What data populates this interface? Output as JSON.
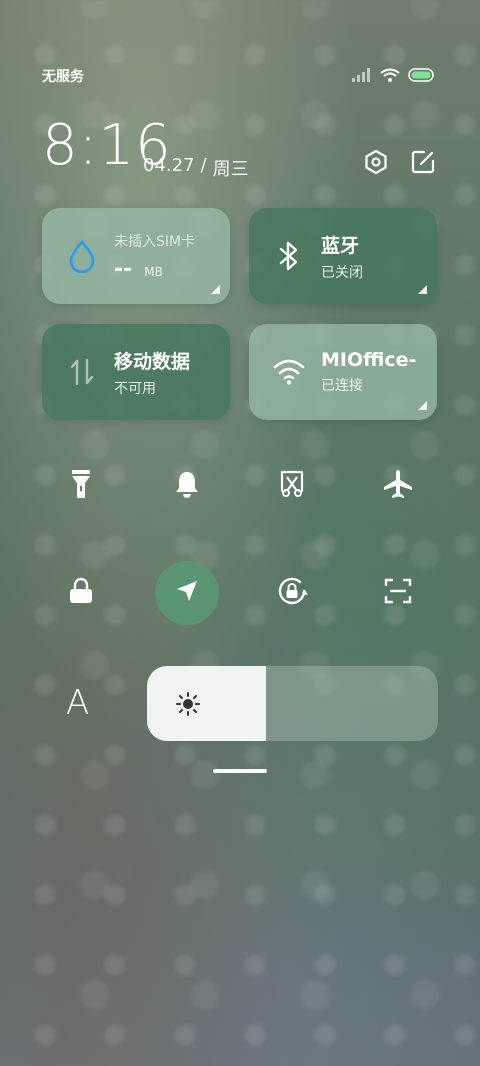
{
  "status_bar": {
    "carrier": "无服务",
    "icons": [
      "signal-icon",
      "wifi-icon",
      "battery-icon"
    ]
  },
  "header": {
    "time": "8:16",
    "date": "04.27",
    "separator": "/",
    "weekday": "周三",
    "actions": [
      "settings-icon",
      "edit-icon"
    ]
  },
  "tiles": [
    {
      "title": "未插入SIM卡",
      "value": "--",
      "unit": "MB",
      "icon": "water-drop-icon"
    },
    {
      "title": "蓝牙",
      "subtitle": "已关闭",
      "icon": "bluetooth-icon"
    },
    {
      "title": "移动数据",
      "subtitle": "不可用",
      "icon": "data-arrows-icon"
    },
    {
      "title": "MIOffice-",
      "subtitle": "已连接",
      "icon": "wifi-icon"
    }
  ],
  "toggles": [
    {
      "name": "flashlight",
      "icon": "flashlight-icon",
      "active": false
    },
    {
      "name": "ringer",
      "icon": "bell-icon",
      "active": false
    },
    {
      "name": "screenshot",
      "icon": "screenshot-icon",
      "active": false
    },
    {
      "name": "airplane",
      "icon": "airplane-icon",
      "active": false
    },
    {
      "name": "lock",
      "icon": "lock-icon",
      "active": false
    },
    {
      "name": "location",
      "icon": "location-icon",
      "active": true
    },
    {
      "name": "rotation-lock",
      "icon": "rotation-lock-icon",
      "active": false
    },
    {
      "name": "scanner",
      "icon": "scan-icon",
      "active": false
    }
  ],
  "brightness": {
    "level": 0.41,
    "icon": "sun-icon"
  },
  "font_toggle": {
    "label": "A"
  },
  "colors": {
    "active_toggle": "#5a9673",
    "tile_dark": "#46785a",
    "accent_blue": "#2f9be8"
  }
}
